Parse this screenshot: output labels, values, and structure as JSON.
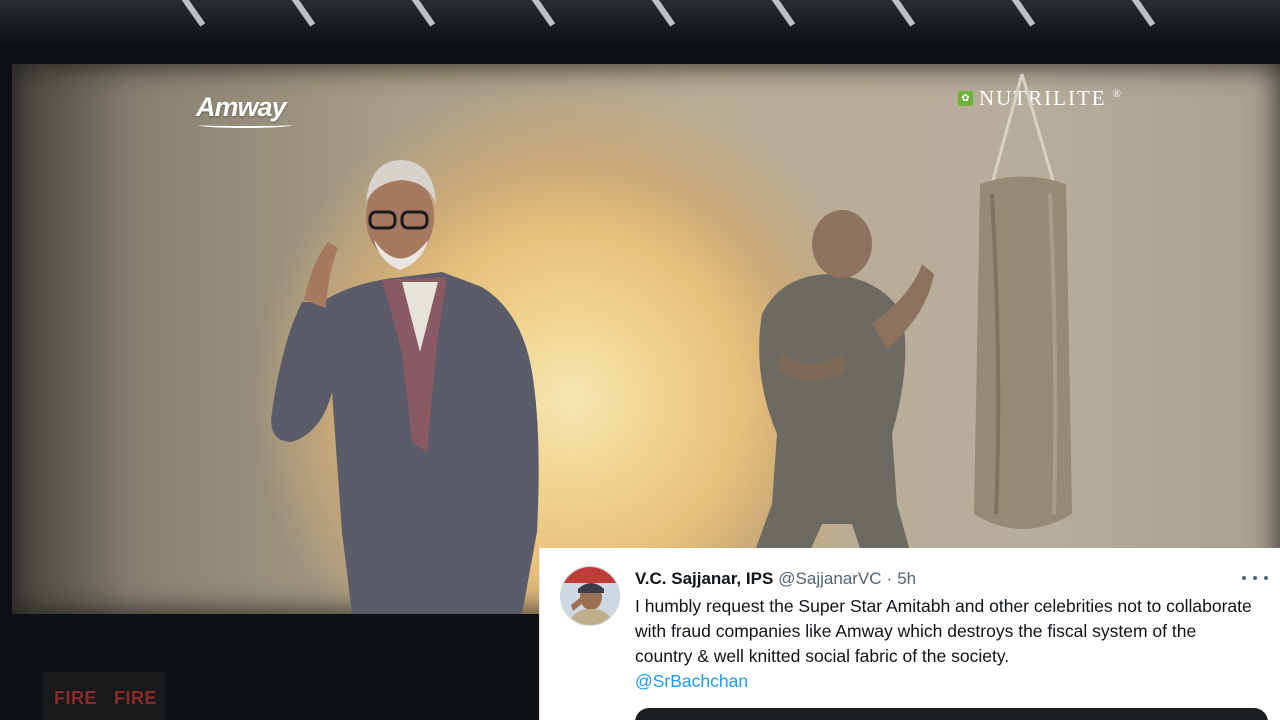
{
  "screen": {
    "brand_left": "Amway",
    "brand_right": "NUTRILITE",
    "brand_right_mark": "®",
    "icons": [
      "leaf-logo-icon"
    ]
  },
  "theatre": {
    "fire_labels": [
      "FIRE",
      "FIRE"
    ]
  },
  "tweet": {
    "display_name": "V.C. Sajjanar, IPS",
    "handle": "@SajjanarVC",
    "separator": "·",
    "time": "5h",
    "text": "I humbly request the Super Star Amitabh and other celebrities not to collaborate with fraud companies like Amway which destroys the fiscal system of the country & well knitted social fabric of the society.",
    "mention": "@SrBachchan",
    "colors": {
      "link": "#1d9bf0",
      "text": "#0f1419",
      "muted": "#536471"
    }
  }
}
